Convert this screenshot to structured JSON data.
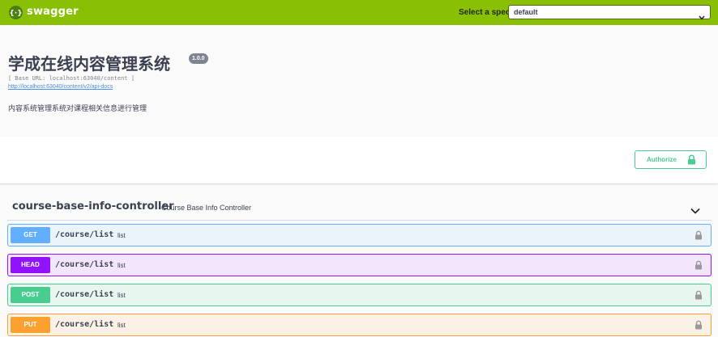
{
  "topbar": {
    "logo_text": "swagger",
    "spec_label": "Select a spec",
    "spec_value": "default",
    "colors": {
      "background": "#89bf04"
    }
  },
  "info": {
    "title": "学成在线内容管理系统",
    "version": "1.0.0",
    "base_url": "[ Base URL: localhost:63040/content ]",
    "docs_link": "http://localhost:63040/content/v2/api-docs",
    "description": "内容系统管理系统对课程相关信息进行管理"
  },
  "authorize": {
    "label": "Authorize",
    "icon": "lock-icon",
    "color": "#49cc90"
  },
  "tag": {
    "name": "course-base-info-controller",
    "description": "Course Base Info Controller",
    "icon": "chevron-down-icon"
  },
  "operations": [
    {
      "method": "GET",
      "path": "/course/list",
      "summary": "list",
      "color": "#61affe"
    },
    {
      "method": "HEAD",
      "path": "/course/list",
      "summary": "list",
      "color": "#9012fe"
    },
    {
      "method": "POST",
      "path": "/course/list",
      "summary": "list",
      "color": "#49cc90"
    },
    {
      "method": "PUT",
      "path": "/course/list",
      "summary": "list",
      "color": "#fca130"
    }
  ]
}
